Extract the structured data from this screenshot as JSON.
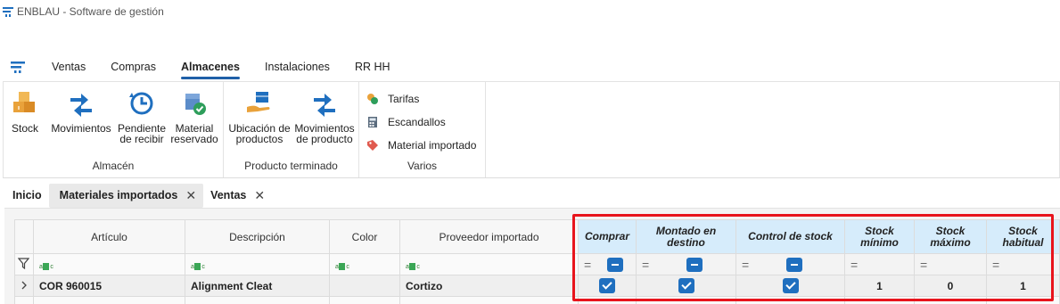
{
  "window": {
    "title": "ENBLAU - Software de gestión"
  },
  "menu": {
    "tabs": [
      {
        "label": "Ventas"
      },
      {
        "label": "Compras"
      },
      {
        "label": "Almacenes"
      },
      {
        "label": "Instalaciones"
      },
      {
        "label": "RR HH"
      }
    ],
    "active": "Almacenes"
  },
  "ribbon": {
    "almacen": {
      "label": "Almacén",
      "buttons": [
        {
          "label": "Stock"
        },
        {
          "label": "Movimientos"
        },
        {
          "label": "Pendiente\nde recibir"
        },
        {
          "label": "Material\nreservado"
        }
      ]
    },
    "producto_terminado": {
      "label": "Producto terminado",
      "buttons": [
        {
          "label": "Ubicación de\nproductos"
        },
        {
          "label": "Movimientos\nde producto"
        }
      ]
    },
    "varios": {
      "label": "Varios",
      "buttons": [
        {
          "label": "Tarifas"
        },
        {
          "label": "Escandallos"
        },
        {
          "label": "Material importado"
        }
      ]
    }
  },
  "doc_tabs": {
    "inicio": "Inicio",
    "materiales": "Materiales importados",
    "ventas": "Ventas",
    "close_glyph": "✕"
  },
  "grid": {
    "columns": [
      {
        "label": "Artículo"
      },
      {
        "label": "Descripción"
      },
      {
        "label": "Color"
      },
      {
        "label": "Proveedor importado"
      },
      {
        "label": "Comprar"
      },
      {
        "label": "Montado en destino"
      },
      {
        "label": "Control de stock"
      },
      {
        "label": "Stock mínimo"
      },
      {
        "label": "Stock máximo"
      },
      {
        "label": "Stock habitual"
      }
    ],
    "filter_glyph": "=",
    "rows": [
      {
        "articulo": "COR 960015",
        "descripcion": "Alignment Cleat",
        "color": "",
        "proveedor": "Cortizo",
        "comprar": true,
        "montado": true,
        "control": true,
        "stock_min": "1",
        "stock_max": "0",
        "stock_hab": "1"
      }
    ]
  },
  "colors": {
    "accent": "#1f5fa8",
    "highlight_header": "#d6ecfb",
    "annotation": "#e8141c"
  }
}
